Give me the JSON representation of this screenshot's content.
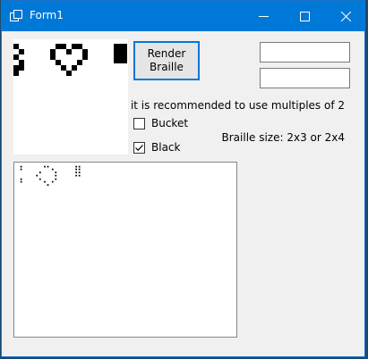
{
  "window": {
    "title": "Form1",
    "icon": "window-app-icon"
  },
  "controls": {
    "render_label": "Render\nBraille",
    "width_input_value": "",
    "height_input_value": "",
    "recommendation_text": "it is recommended to use multiples of 2",
    "braille_size_text": "Braille size: 2x3 or 2x4",
    "bucket_label": "Bucket",
    "bucket_checked": false,
    "black_label": "Black",
    "black_checked": true
  },
  "output": {
    "text": "⠃⠀⡠⠉⢢⠀⠀⣿\n⠃⠀⠈⠢⠊"
  },
  "colors": {
    "titlebar": "#0078d7",
    "window_bg": "#f0f0f0",
    "button_border": "#0078d7",
    "pixel": "#000000"
  }
}
